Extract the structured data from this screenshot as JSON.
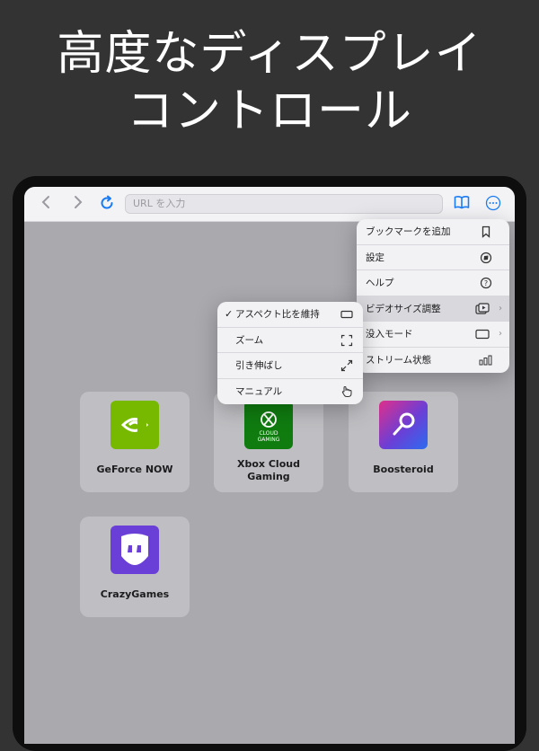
{
  "headline": {
    "line1": "高度なディスプレイ",
    "line2": "コントロール"
  },
  "toolbar": {
    "back": "‹",
    "forward": "›",
    "reload": "↻",
    "url_placeholder": "URL を入力",
    "bookmarks_icon": "book-icon",
    "more_icon": "more-icon"
  },
  "tiles": [
    {
      "label": "GeForce NOW",
      "color": "#76b900"
    },
    {
      "label": "Xbox Cloud Gaming",
      "sublabel1": "Xbox Cloud",
      "sublabel2": "Gaming",
      "logo_text1": "CLOUD",
      "logo_text2": "GAMING",
      "color": "#107c10"
    },
    {
      "label": "Boosteroid",
      "color": "#5a3fd6"
    },
    {
      "label": "CrazyGames",
      "color": "#6a3fd8"
    }
  ],
  "main_menu": [
    {
      "label": "ブックマークを追加",
      "icon": "bookmark-icon"
    },
    {
      "label": "設定",
      "icon": "compass-icon"
    },
    {
      "label": "ヘルプ",
      "icon": "help-icon"
    },
    {
      "label": "ビデオサイズ調整",
      "icon": "video-icon",
      "submenu": true,
      "highlighted": true
    },
    {
      "label": "没入モード",
      "icon": "rectangle-icon",
      "submenu": true
    },
    {
      "label": "ストリーム状態",
      "icon": "bars-icon"
    }
  ],
  "video_menu": [
    {
      "label": "アスペクト比を維持",
      "icon": "aspect-icon",
      "checked": true
    },
    {
      "label": "ズーム",
      "icon": "fullscreen-icon"
    },
    {
      "label": "引き伸ばし",
      "icon": "stretch-icon"
    },
    {
      "label": "マニュアル",
      "icon": "hand-icon"
    }
  ],
  "check_mark": "✓",
  "chevron": "›"
}
